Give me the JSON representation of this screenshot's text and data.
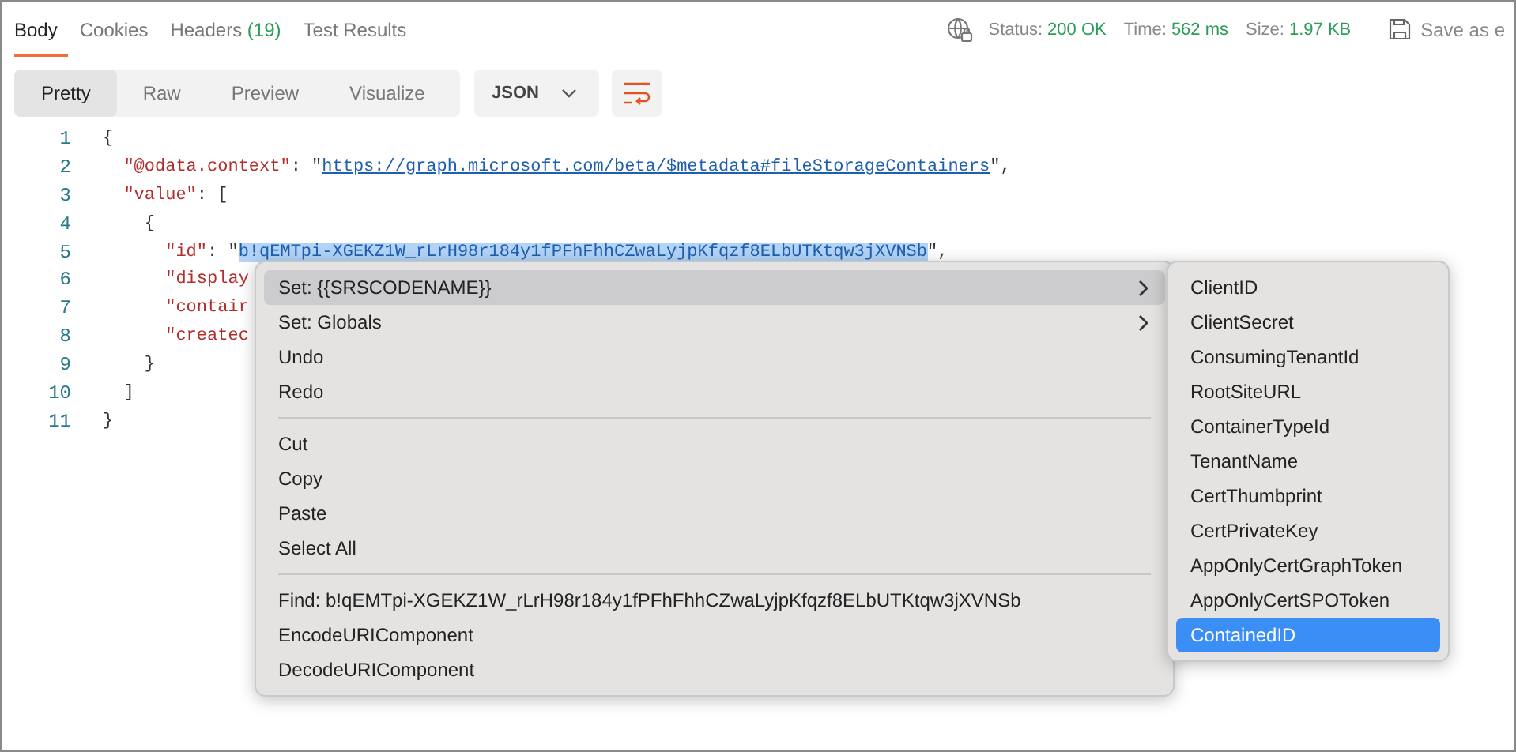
{
  "tabs": [
    {
      "label": "Body",
      "selected": true
    },
    {
      "label": "Cookies",
      "selected": false
    },
    {
      "label": "Headers",
      "count": "(19)",
      "selected": false
    },
    {
      "label": "Test Results",
      "selected": false
    }
  ],
  "status": {
    "status_label": "Status:",
    "status": "200 OK",
    "time_label": "Time:",
    "time": "562 ms",
    "size_label": "Size:",
    "size": "1.97 KB",
    "save": "Save as e"
  },
  "view_modes": [
    {
      "label": "Pretty",
      "selected": true
    },
    {
      "label": "Raw",
      "selected": false
    },
    {
      "label": "Preview",
      "selected": false
    },
    {
      "label": "Visualize",
      "selected": false
    }
  ],
  "format": "JSON",
  "code_lines": [
    {
      "number": "1",
      "tokens": [
        {
          "kind": "punct",
          "text": "{"
        }
      ]
    },
    {
      "number": "2",
      "tokens": [
        {
          "kind": "key",
          "text": "  \"@odata.context\""
        },
        {
          "kind": "punct",
          "text": ": "
        },
        {
          "kind": "string",
          "text": "\""
        },
        {
          "kind": "link",
          "text": "https://graph.microsoft.com/beta/$metadata#fileStorageContainers"
        },
        {
          "kind": "string",
          "text": "\""
        },
        {
          "kind": "punct",
          "text": ","
        }
      ]
    },
    {
      "number": "3",
      "tokens": [
        {
          "kind": "key",
          "text": "  \"value\""
        },
        {
          "kind": "punct",
          "text": ": ["
        }
      ]
    },
    {
      "number": "4",
      "tokens": [
        {
          "kind": "punct",
          "text": "    {"
        }
      ]
    },
    {
      "number": "5",
      "tokens": [
        {
          "kind": "key",
          "text": "      \"id\""
        },
        {
          "kind": "punct",
          "text": ": "
        },
        {
          "kind": "string",
          "text": "\""
        },
        {
          "kind": "selection",
          "text": "b!qEMTpi-XGEKZ1W_rLrH98r184y1fPFhFhhCZwaLyjpKfqzf8ELbUTKtqw3jXVNSb"
        },
        {
          "kind": "string",
          "text": "\""
        },
        {
          "kind": "punct",
          "text": ","
        }
      ]
    },
    {
      "number": "6",
      "tokens": [
        {
          "kind": "key",
          "text": "      \"display"
        }
      ]
    },
    {
      "number": "7",
      "tokens": [
        {
          "kind": "key",
          "text": "      \"contair"
        }
      ]
    },
    {
      "number": "8",
      "tokens": [
        {
          "kind": "key",
          "text": "      \"createc"
        }
      ]
    },
    {
      "number": "9",
      "tokens": [
        {
          "kind": "punct",
          "text": "    }"
        }
      ]
    },
    {
      "number": "10",
      "tokens": [
        {
          "kind": "punct",
          "text": "  ]"
        }
      ]
    },
    {
      "number": "11",
      "tokens": [
        {
          "kind": "punct",
          "text": "}"
        }
      ]
    }
  ],
  "context_menu": [
    {
      "kind": "item",
      "label": "Set: {{SRSCODENAME}}",
      "submenu": true,
      "selected": true
    },
    {
      "kind": "item",
      "label": "Set: Globals",
      "submenu": true,
      "selected": false
    },
    {
      "kind": "item",
      "label": "Undo",
      "submenu": false,
      "selected": false
    },
    {
      "kind": "item",
      "label": "Redo",
      "submenu": false,
      "selected": false
    },
    {
      "kind": "separator"
    },
    {
      "kind": "item",
      "label": "Cut",
      "submenu": false,
      "selected": false
    },
    {
      "kind": "item",
      "label": "Copy",
      "submenu": false,
      "selected": false
    },
    {
      "kind": "item",
      "label": "Paste",
      "submenu": false,
      "selected": false
    },
    {
      "kind": "item",
      "label": "Select All",
      "submenu": false,
      "selected": false
    },
    {
      "kind": "separator"
    },
    {
      "kind": "item",
      "label": "Find: b!qEMTpi-XGEKZ1W_rLrH98r184y1fPFhFhhCZwaLyjpKfqzf8ELbUTKtqw3jXVNSb",
      "submenu": false,
      "selected": false
    },
    {
      "kind": "item",
      "label": "EncodeURIComponent",
      "submenu": false,
      "selected": false
    },
    {
      "kind": "item",
      "label": "DecodeURIComponent",
      "submenu": false,
      "selected": false
    }
  ],
  "submenu": [
    {
      "label": "ClientID",
      "selected": false
    },
    {
      "label": "ClientSecret",
      "selected": false
    },
    {
      "label": "ConsumingTenantId",
      "selected": false
    },
    {
      "label": "RootSiteURL",
      "selected": false
    },
    {
      "label": "ContainerTypeId",
      "selected": false
    },
    {
      "label": "TenantName",
      "selected": false
    },
    {
      "label": "CertThumbprint",
      "selected": false
    },
    {
      "label": "CertPrivateKey",
      "selected": false
    },
    {
      "label": "AppOnlyCertGraphToken",
      "selected": false
    },
    {
      "label": "AppOnlyCertSPOToken",
      "selected": false
    },
    {
      "label": "ContainedID",
      "selected": true
    }
  ]
}
